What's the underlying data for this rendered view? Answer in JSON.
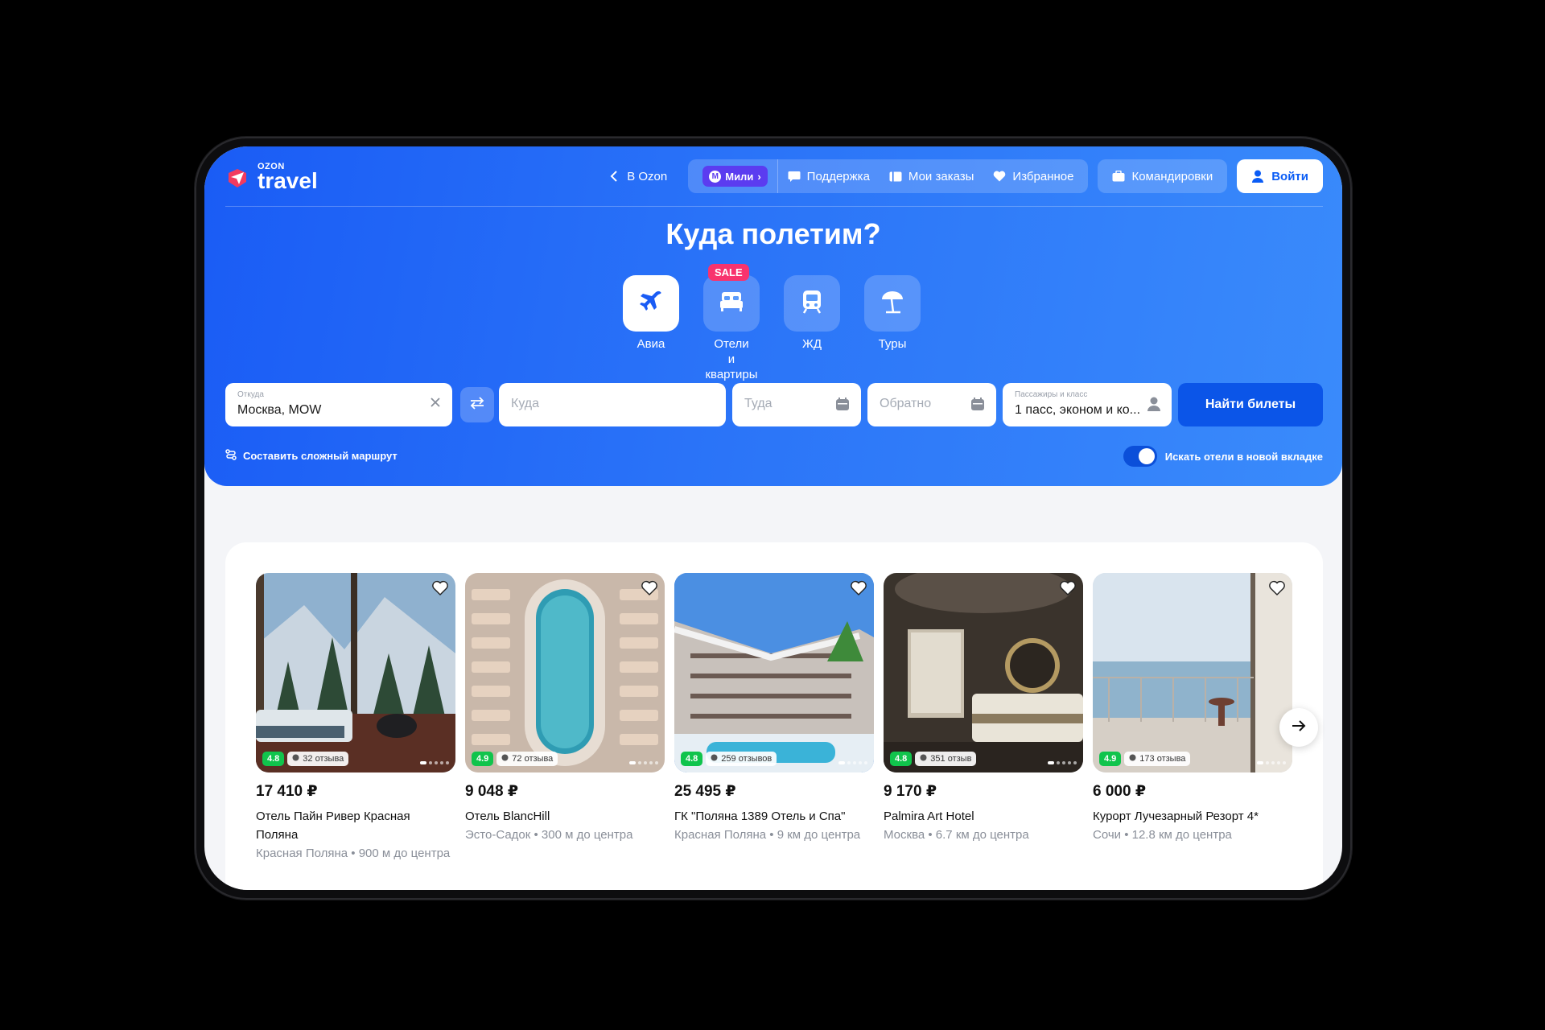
{
  "brand": {
    "small": "OZON",
    "big": "travel"
  },
  "nav": {
    "back_label": "В Ozon",
    "miles_label": "Мили",
    "support_label": "Поддержка",
    "orders_label": "Мои заказы",
    "favorites_label": "Избранное",
    "business_label": "Командировки",
    "login_label": "Войти"
  },
  "hero": {
    "title": "Куда полетим?"
  },
  "modes": [
    {
      "label": "Авиа",
      "icon": "plane-icon"
    },
    {
      "label": "Отели\nи квартиры",
      "icon": "bed-icon",
      "badge": "SALE"
    },
    {
      "label": "ЖД",
      "icon": "train-icon"
    },
    {
      "label": "Туры",
      "icon": "umbrella-icon"
    }
  ],
  "search": {
    "from_label": "Откуда",
    "from_value": "Москва, MOW",
    "to_placeholder": "Куда",
    "depart_placeholder": "Туда",
    "return_placeholder": "Обратно",
    "pax_label": "Пассажиры и класс",
    "pax_value": "1 пасс, эконом и ко...",
    "find_label": "Найти билеты"
  },
  "options": {
    "complex_route_label": "Составить сложный маршрут",
    "new_tab_label": "Искать отели в новой вкладке",
    "new_tab_on": true
  },
  "hotels": [
    {
      "price": "17 410 ₽",
      "name": "Отель Пайн Ривер Красная Поляна",
      "location": "Красная Поляна • 900 м до центра",
      "rating": "4.8",
      "reviews": "32 отзыва"
    },
    {
      "price": "9 048 ₽",
      "name": "Отель BlancHill",
      "location": "Эсто-Садок • 300 м до центра",
      "rating": "4.9",
      "reviews": "72 отзыва"
    },
    {
      "price": "25 495 ₽",
      "name": "ГК \"Поляна 1389 Отель и Спа\"",
      "location": "Красная Поляна • 9 км до центра",
      "rating": "4.8",
      "reviews": "259 отзывов"
    },
    {
      "price": "9 170 ₽",
      "name": "Palmira Art Hotel",
      "location": "Москва • 6.7 км до центра",
      "rating": "4.8",
      "reviews": "351 отзыв"
    },
    {
      "price": "6 000 ₽",
      "name": "Курорт Лучезарный Резорт 4*",
      "location": "Сочи • 12.8 км до центра",
      "rating": "4.9",
      "reviews": "173 отзыва"
    }
  ],
  "colors": {
    "accent": "#1a5cf5",
    "button": "#0b55e8",
    "sale": "#f8336e",
    "rating": "#10c44c",
    "miles": "#5b3cf0"
  }
}
